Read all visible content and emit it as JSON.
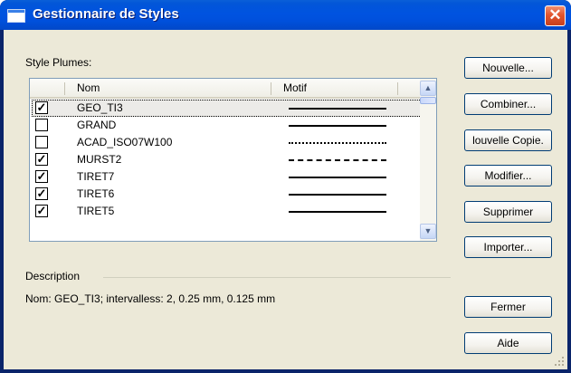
{
  "window": {
    "title": "Gestionnaire de Styles",
    "close_glyph": "✕"
  },
  "list": {
    "label": "Style Plumes:",
    "columns": {
      "name": "Nom",
      "pattern": "Motif"
    },
    "rows": [
      {
        "checked": true,
        "name": "GEO_TI3",
        "pattern": "solid"
      },
      {
        "checked": false,
        "name": "GRAND",
        "pattern": "solid"
      },
      {
        "checked": false,
        "name": "ACAD_ISO07W100",
        "pattern": "dotted"
      },
      {
        "checked": true,
        "name": "MURST2",
        "pattern": "fine-dashed"
      },
      {
        "checked": true,
        "name": "TIRET7",
        "pattern": "solid"
      },
      {
        "checked": true,
        "name": "TIRET6",
        "pattern": "solid"
      },
      {
        "checked": true,
        "name": "TIRET5",
        "pattern": "solid"
      }
    ],
    "check_glyph": "✓",
    "scroll_up": "▲",
    "scroll_down": "▼"
  },
  "description": {
    "label": "Description",
    "text": "Nom: GEO_TI3; intervalless: 2, 0.25 mm, 0.125 mm"
  },
  "buttons": {
    "new": "Nouvelle...",
    "combine": "Combiner...",
    "new_copy": "louvelle Copie.",
    "modify": "Modifier...",
    "delete": "Supprimer",
    "import": "Importer...",
    "close": "Fermer",
    "help": "Aide"
  },
  "colors": {
    "titlebar": "#0054e3",
    "close_button": "#e2552e",
    "dialog_face": "#ece9d8"
  }
}
